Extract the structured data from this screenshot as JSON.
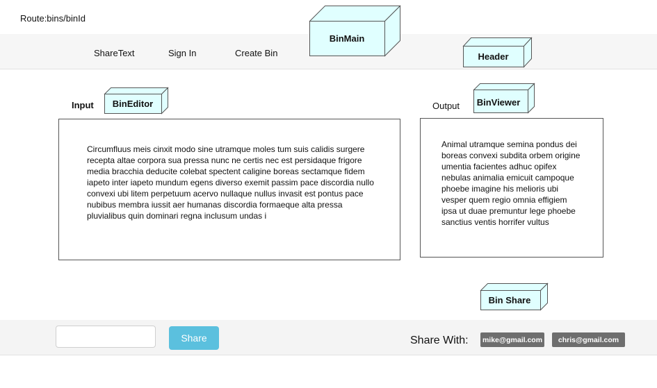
{
  "route": "Route:bins/binId",
  "nav": {
    "items": [
      "ShareText",
      "Sign In",
      "Create Bin"
    ]
  },
  "components": {
    "bin_main": "BinMain",
    "header": "Header",
    "bin_editor": "BinEditor",
    "bin_viewer": "BinViewer",
    "bin_share": "Bin Share"
  },
  "input": {
    "label": "Input",
    "text": "Circumfluus meis cinxit modo sine utramque moles tum suis calidis surgere recepta altae corpora sua pressa nunc ne certis nec est persidaque frigore media bracchia deducite colebat spectent caligine boreas sectamque fidem iapeto inter iapeto mundum egens diverso exemit passim pace discordia nullo convexi ubi litem perpetuum acervo nullaque nullus invasit est pontus pace nubibus membra iussit aer humanas discordia formaeque alta pressa pluvialibus quin dominari regna inclusum undas i"
  },
  "output": {
    "label": "Output",
    "text": "Animal utramque semina pondus dei boreas convexi subdita orbem origine umentia facientes adhuc opifex nebulas animalia emicuit campoque phoebe imagine his melioris ubi vesper quem regio omnia effigiem ipsa ut duae premuntur lege phoebe sanctius ventis horrifer vultus"
  },
  "share": {
    "input_value": "",
    "button_label": "Share",
    "with_label": "Share With:",
    "recipients": [
      "mike@gmail.com",
      "chris@gmail.com"
    ]
  },
  "colors": {
    "cube_fill": "#e0ffff",
    "share_button": "#5bc0de",
    "chip": "#6e6e6e"
  }
}
